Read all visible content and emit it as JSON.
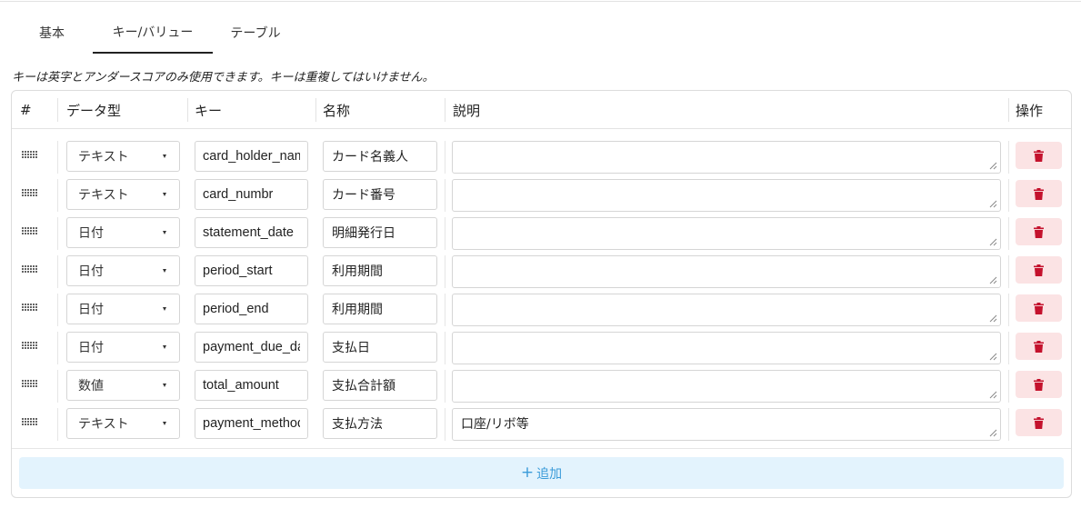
{
  "tabs": [
    {
      "label": "基本",
      "active": false
    },
    {
      "label": "キー/バリュー",
      "active": true
    },
    {
      "label": "テーブル",
      "active": false
    }
  ],
  "hint": "キーは英字とアンダースコアのみ使用できます。キーは重複してはいけません。",
  "columns": {
    "index": "#",
    "type": "データ型",
    "key": "キー",
    "name": "名称",
    "description": "説明",
    "actions": "操作"
  },
  "rows": [
    {
      "type": "テキスト",
      "key": "card_holder_name",
      "name": "カード名義人",
      "description": ""
    },
    {
      "type": "テキスト",
      "key": "card_numbr",
      "name": "カード番号",
      "description": ""
    },
    {
      "type": "日付",
      "key": "statement_date",
      "name": "明細発行日",
      "description": ""
    },
    {
      "type": "日付",
      "key": "period_start",
      "name": "利用期間",
      "description": ""
    },
    {
      "type": "日付",
      "key": "period_end",
      "name": "利用期間",
      "description": ""
    },
    {
      "type": "日付",
      "key": "payment_due_date",
      "name": "支払日",
      "description": ""
    },
    {
      "type": "数値",
      "key": "total_amount",
      "name": "支払合計額",
      "description": ""
    },
    {
      "type": "テキスト",
      "key": "payment_method",
      "name": "支払方法",
      "description": "口座/リボ等"
    }
  ],
  "add_button": {
    "icon": "+",
    "label": "追加"
  },
  "icons": {
    "drag": "drag-handle-icon",
    "delete": "trash-icon",
    "add": "plus-icon",
    "select": "caret-down-icon"
  },
  "colors": {
    "accent": "#3a9bd9",
    "add_bg": "#e3f3fd",
    "delete_bg": "#fbe3e4",
    "delete_icon": "#c4122d"
  }
}
